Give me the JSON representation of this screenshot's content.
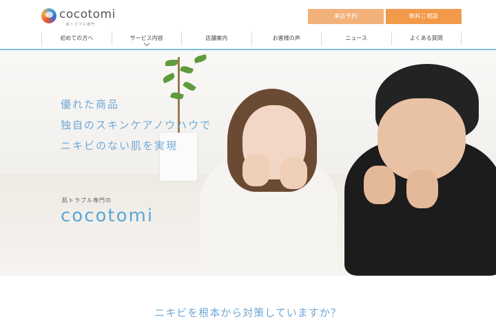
{
  "brand": {
    "name": "cocotomi",
    "subtitle": "肌トラブル専門"
  },
  "header": {
    "buttons": {
      "reserve": "来店予約",
      "consult": "無料ご相談"
    },
    "nav": [
      {
        "label": "初めての方へ"
      },
      {
        "label": "サービス内容"
      },
      {
        "label": "店舗案内"
      },
      {
        "label": "お客様の声"
      },
      {
        "label": "ニュース"
      },
      {
        "label": "よくある質問"
      }
    ]
  },
  "hero": {
    "taglines": [
      "優れた商品",
      "独自のスキンケアノウハウで",
      "ニキビのない肌を実現"
    ],
    "sub": "肌トラブル専門の",
    "brand": "cocotomi"
  },
  "section": {
    "heading": "ニキビを根本から対策していますか？"
  },
  "colors": {
    "accent_blue": "#6fa8d6",
    "reserve_button": "#f2b179",
    "consult_button": "#f29a4a"
  }
}
